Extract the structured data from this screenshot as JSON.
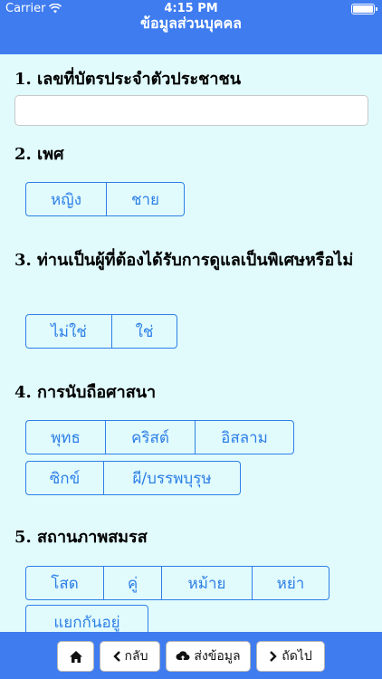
{
  "status_bar": {
    "carrier": "Carrier",
    "time": "4:15 PM"
  },
  "header": {
    "title": "ข้อมูลส่วนบุคคล"
  },
  "questions": {
    "q1": {
      "label": "1. เลขที่บัตรประจำตัวประชาชน",
      "value": "",
      "placeholder": ""
    },
    "q2": {
      "label": "2. เพศ",
      "options": [
        "หญิง",
        "ชาย"
      ]
    },
    "q3": {
      "label": "3. ท่านเป็นผู้ที่ต้องได้รับการดูแลเป็นพิเศษหรือไม่",
      "options": [
        "ไม่ใช่",
        "ใช่"
      ]
    },
    "q4": {
      "label": "4. การนับถือศาสนา",
      "options": [
        "พุทธ",
        "คริสต์",
        "อิสลาม",
        "ซิกข์",
        "ผี/บรรพบุรุษ"
      ]
    },
    "q5": {
      "label": "5. สถานภาพสมรส",
      "options": [
        "โสด",
        "คู่",
        "หม้าย",
        "หย่า",
        "แยกกันอยู่"
      ]
    }
  },
  "toolbar": {
    "home_icon": "home-icon",
    "back_label": "กลับ",
    "send_label": "ส่งข้อมูล",
    "next_label": "ถัดไป"
  },
  "colors": {
    "bar": "#3f7cf0",
    "background": "#e1fbfd",
    "accent": "#2d7fe6"
  }
}
